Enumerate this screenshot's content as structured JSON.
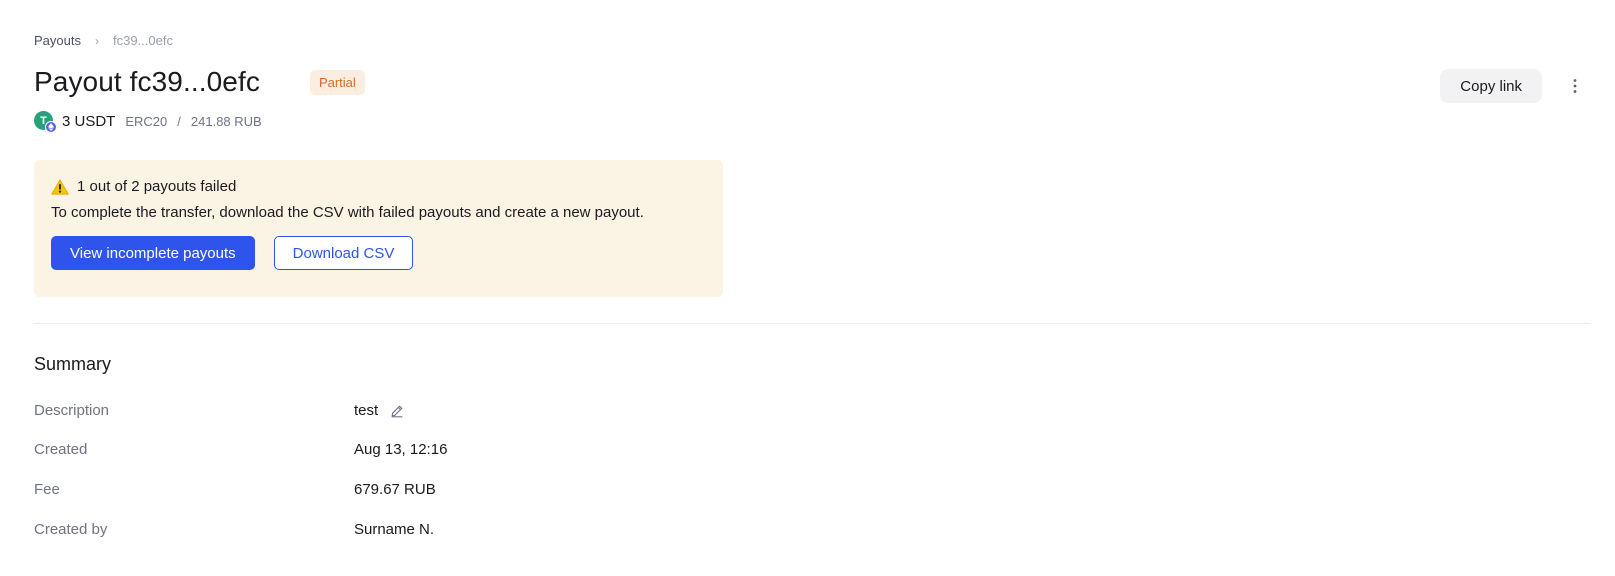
{
  "breadcrumb": {
    "parent": "Payouts",
    "separator": "›",
    "current": "fc39...0efc"
  },
  "header": {
    "title": "Payout fc39...0efc",
    "status": "Partial",
    "copy_link_label": "Copy link",
    "more_icon": "more-vertical-icon"
  },
  "amount": {
    "coin_icon": "tether-icon",
    "network_icon": "ethereum-icon",
    "coin_letter": "T",
    "value": "3 USDT",
    "network": "ERC20",
    "separator": "/",
    "fiat": "241.88 RUB"
  },
  "alert": {
    "icon": "warning-icon",
    "title": "1 out of 2 payouts failed",
    "text": "To complete the transfer, download the CSV with failed payouts and create a new payout.",
    "primary_label": "View incomplete payouts",
    "secondary_label": "Download CSV"
  },
  "summary": {
    "title": "Summary",
    "rows": [
      {
        "label": "Description",
        "value": "test",
        "editable": true
      },
      {
        "label": "Created",
        "value": "Aug 13, 12:16"
      },
      {
        "label": "Fee",
        "value": "679.67 RUB"
      },
      {
        "label": "Created by",
        "value": "Surname N."
      }
    ]
  },
  "colors": {
    "accent": "#2f54eb",
    "status_bg": "#fbeee0",
    "status_text": "#d9682d",
    "alert_bg": "#fbf4e5"
  }
}
